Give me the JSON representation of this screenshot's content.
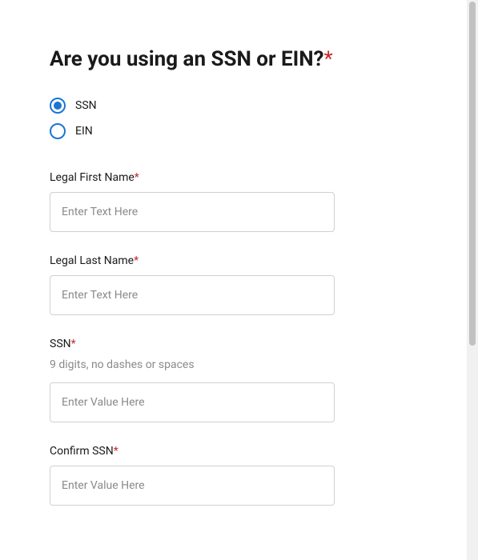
{
  "heading": {
    "text": "Are you using an SSN or EIN?",
    "required": "*"
  },
  "radio": {
    "options": [
      {
        "label": "SSN",
        "selected": true
      },
      {
        "label": "EIN",
        "selected": false
      }
    ]
  },
  "fields": {
    "firstName": {
      "label": "Legal First Name",
      "required": "*",
      "placeholder": "Enter Text Here",
      "value": ""
    },
    "lastName": {
      "label": "Legal Last Name",
      "required": "*",
      "placeholder": "Enter Text Here",
      "value": ""
    },
    "ssn": {
      "label": "SSN",
      "required": "*",
      "helper": "9 digits, no dashes or spaces",
      "placeholder": "Enter Value Here",
      "value": ""
    },
    "confirmSsn": {
      "label": "Confirm SSN",
      "required": "*",
      "placeholder": "Enter Value Here",
      "value": ""
    }
  }
}
